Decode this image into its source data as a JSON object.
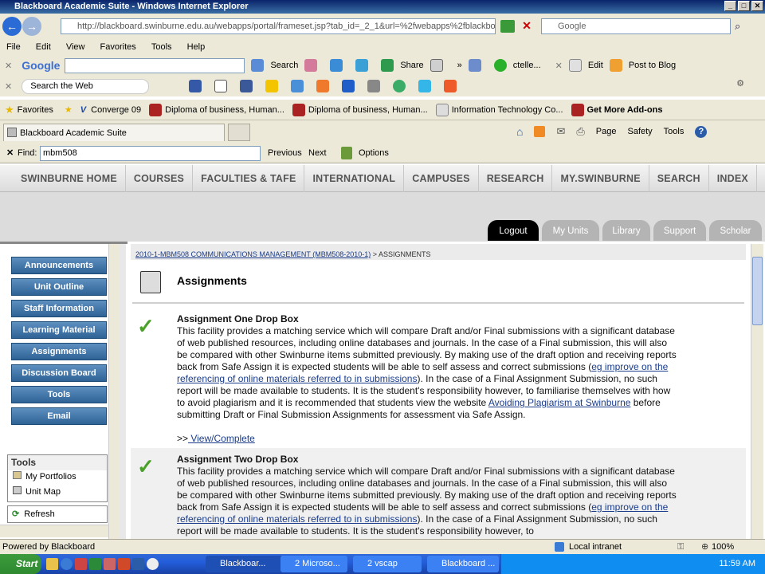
{
  "window": {
    "title": "Blackboard Academic Suite - Windows Internet Explorer"
  },
  "address": {
    "url": "http://blackboard.swinburne.edu.au/webapps/portal/frameset.jsp?tab_id=_2_1&url=%2fwebapps%2fblackboar",
    "search_placeholder": "Google"
  },
  "menu": [
    "File",
    "Edit",
    "View",
    "Favorites",
    "Tools",
    "Help"
  ],
  "google_toolbar": {
    "logo": "Google",
    "search": "Search",
    "share": "Share",
    "user": "ctelle...",
    "edit": "Edit",
    "post": "Post to Blog"
  },
  "web_toolbar": {
    "search_label": "Search the Web"
  },
  "favorites": {
    "label": "Favorites",
    "items": [
      "Converge 09",
      "Diploma of business, Human...",
      "Diploma of business, Human...",
      "Information Technology Co...",
      "Get More Add-ons"
    ]
  },
  "browser_tab": {
    "label": "Blackboard Academic Suite"
  },
  "command_bar": {
    "page": "Page",
    "safety": "Safety",
    "tools": "Tools"
  },
  "find": {
    "label": "Find:",
    "value": "mbm508",
    "previous": "Previous",
    "next": "Next",
    "options": "Options"
  },
  "site_nav": [
    "SWINBURNE HOME",
    "COURSES",
    "FACULTIES & TAFE",
    "INTERNATIONAL",
    "CAMPUSES",
    "RESEARCH",
    "MY.SWINBURNE",
    "SEARCH",
    "INDEX"
  ],
  "tabs": [
    "Logout",
    "My Units",
    "Library",
    "Support",
    "Scholar"
  ],
  "sidebar": {
    "buttons": [
      "Announcements",
      "Unit Outline",
      "Staff Information",
      "Learning Material",
      "Assignments",
      "Discussion Board",
      "Tools",
      "Email"
    ],
    "tools_title": "Tools",
    "tools_items": [
      "My Portfolios",
      "Unit Map"
    ],
    "refresh": "Refresh"
  },
  "breadcrumb": {
    "unit": "2010-1-MBM508 COMMUNICATIONS MANAGEMENT (MBM508-2010-1)",
    "sep": ">",
    "current": "ASSIGNMENTS"
  },
  "page_title": "Assignments",
  "assignments": [
    {
      "title": "Assignment One Drop Box",
      "text1": "This facility provides a matching service which will compare Draft and/or Final submissions with a significant database of web published resources, including online databases and journals. In the case of a Final submission, this will also be compared with other Swinburne items submitted previously. By making use of the draft option and receiving reports back from Safe Assign it is expected students will be able to self assess and correct submissions (",
      "link1": "eg improve on the referencing of online materials referred to in submissions",
      "text2": "). In the case of a Final Assignment Submission, no such report will be made available to students. It is the student's responsibility however, to familiarise themselves with how to avoid plagiarism and it is recommended that students view the website ",
      "link2": "Avoiding Plagiarism at Swinburne",
      "text3": " before submitting Draft or Final Submission Assignments for assessment via Safe Assign.",
      "action_prefix": ">>",
      "action": " View/Complete"
    },
    {
      "title": "Assignment Two Drop Box",
      "text1": "This facility provides a matching service which will compare Draft and/or Final submissions with a significant database of web published resources, including online databases and journals. In the case of a Final submission, this will also be compared with other Swinburne items submitted previously. By making use of the draft option and receiving reports back from Safe Assign it is expected students will be able to self assess and correct submissions (",
      "link1": "eg improve on the referencing of online materials referred to in submissions",
      "text2": "). In the case of a Final Assignment Submission, no such report will be made available to students. It is the student's responsibility however, to"
    }
  ],
  "status": {
    "left": "Powered by Blackboard",
    "zone": "Local intranet",
    "zoom": "100%"
  },
  "taskbar": {
    "start": "Start",
    "tasks": [
      "Blackboar...",
      "2 Microso...",
      "2 vscap",
      "Blackboard ..."
    ],
    "time": "11:59 AM"
  }
}
